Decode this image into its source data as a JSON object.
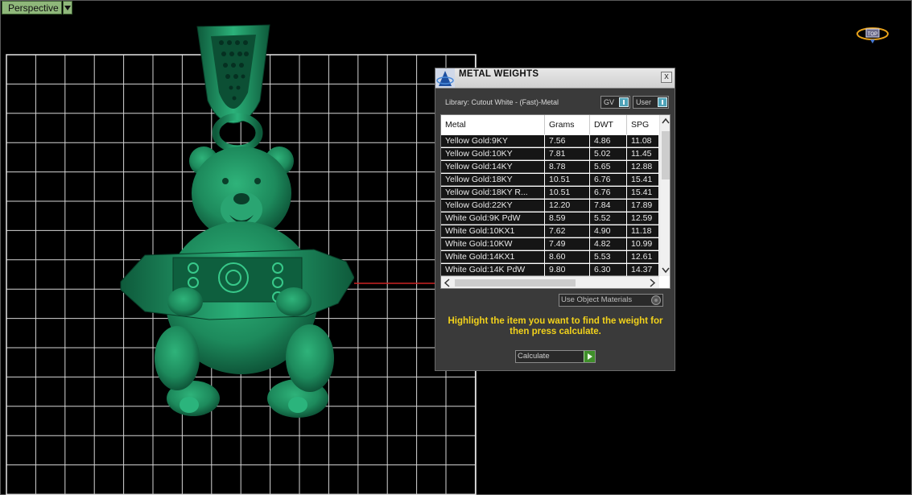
{
  "viewport": {
    "label": "Perspective",
    "dropdown_icon": "chevron-down-icon",
    "nav_icon": "view-cube-icon"
  },
  "dialog": {
    "title": "METAL WEIGHTS",
    "close_label": "x",
    "library_label": "Library: Cutout White - (Fast)-Metal",
    "toggle_gv": "GV",
    "toggle_user": "User",
    "columns": [
      "Metal",
      "Grams",
      "DWT",
      "SPG"
    ],
    "rows": [
      [
        "Yellow Gold:9KY",
        "7.56",
        "4.86",
        "11.08"
      ],
      [
        "Yellow Gold:10KY",
        "7.81",
        "5.02",
        "11.45"
      ],
      [
        "Yellow Gold:14KY",
        "8.78",
        "5.65",
        "12.88"
      ],
      [
        "Yellow Gold:18KY",
        "10.51",
        "6.76",
        "15.41"
      ],
      [
        "Yellow Gold:18KY R...",
        "10.51",
        "6.76",
        "15.41"
      ],
      [
        "Yellow Gold:22KY",
        "12.20",
        "7.84",
        "17.89"
      ],
      [
        "White Gold:9K PdW",
        "8.59",
        "5.52",
        "12.59"
      ],
      [
        "White Gold:10KX1",
        "7.62",
        "4.90",
        "11.18"
      ],
      [
        "White Gold:10KW",
        "7.49",
        "4.82",
        "10.99"
      ],
      [
        "White Gold:14KX1",
        "8.60",
        "5.53",
        "12.61"
      ],
      [
        "White Gold:14K PdW",
        "9.80",
        "6.30",
        "14.37"
      ]
    ],
    "use_object_materials": "Use Object Materials",
    "hint": "Highlight the item you want to find the weight for then press calculate.",
    "calculate_label": "Calculate"
  },
  "colors": {
    "viewport_bg": "#000000",
    "grid": "#d6d6d6",
    "model": "#1f8a5e",
    "hint_text": "#f2d21b",
    "axis_line": "#cc2222"
  }
}
